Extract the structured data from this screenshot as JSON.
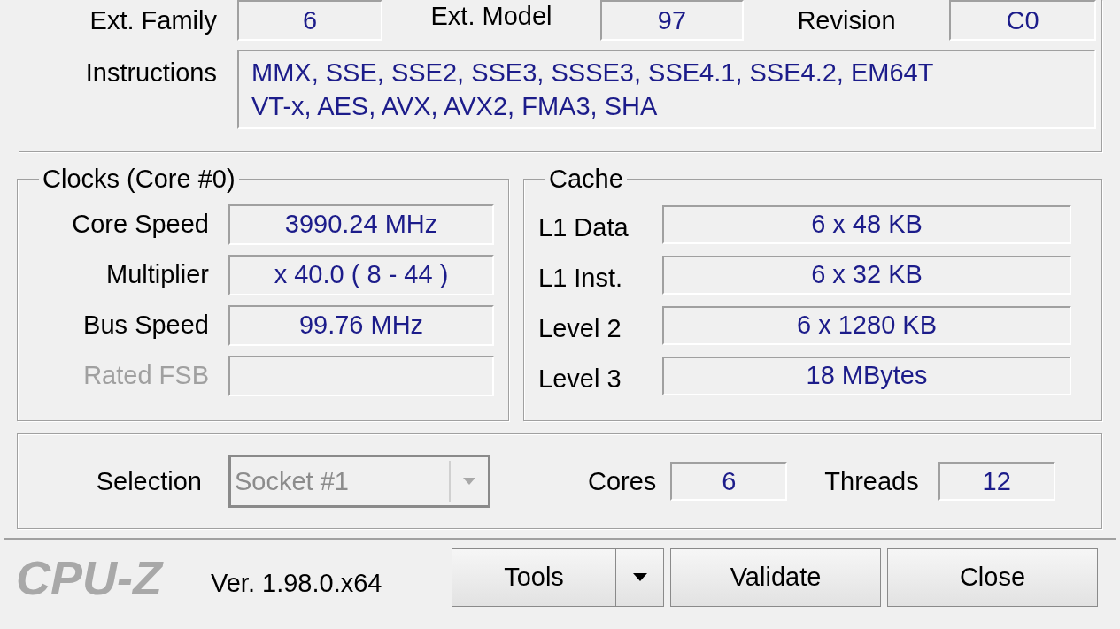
{
  "processor": {
    "fields": [
      {
        "label": "Ext. Family",
        "value": "6"
      },
      {
        "label": "Ext. Model",
        "value": "97"
      },
      {
        "label": "Revision",
        "value": "C0"
      }
    ],
    "instructions": {
      "label": "Instructions",
      "lines": [
        "MMX, SSE, SSE2, SSE3, SSSE3, SSE4.1, SSE4.2, EM64T",
        "VT-x, AES, AVX, AVX2, FMA3, SHA"
      ]
    }
  },
  "clocks": {
    "title": "Clocks (Core #0)",
    "rows": [
      {
        "label": "Core Speed",
        "value": "3990.24 MHz",
        "disabled": false
      },
      {
        "label": "Multiplier",
        "value": "x 40.0 ( 8 - 44 )",
        "disabled": false
      },
      {
        "label": "Bus Speed",
        "value": "99.76 MHz",
        "disabled": false
      },
      {
        "label": "Rated FSB",
        "disabled": true
      }
    ]
  },
  "cache": {
    "title": "Cache",
    "rows": [
      {
        "label": "L1 Data",
        "value": "6 x 48 KB"
      },
      {
        "label": "L1 Inst.",
        "value": "6 x 32 KB"
      },
      {
        "label": "Level 2",
        "value": "6 x 1280 KB"
      },
      {
        "label": "Level 3",
        "value": "18 MBytes"
      }
    ]
  },
  "selection": {
    "label": "Selection",
    "dropdown": {
      "value": "Socket #1",
      "disabled": true
    },
    "cores": {
      "label": "Cores",
      "value": "6"
    },
    "threads": {
      "label": "Threads",
      "value": "12"
    }
  },
  "footer": {
    "logo": "CPU-Z",
    "version": "Ver. 1.98.0.x64",
    "buttons": [
      {
        "label": "Tools",
        "kind": "split"
      },
      {
        "label": "Validate",
        "kind": "plain"
      },
      {
        "label": "Close",
        "kind": "plain"
      }
    ]
  }
}
